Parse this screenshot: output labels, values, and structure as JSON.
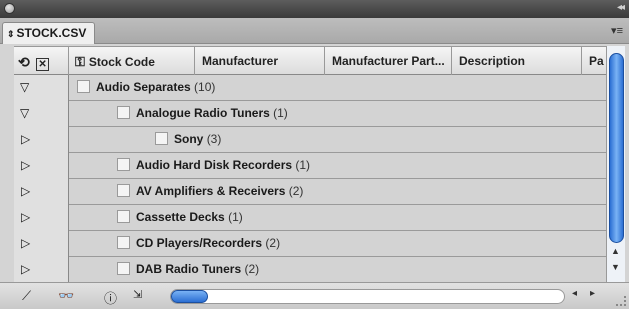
{
  "panel": {
    "tab_title": "STOCK.CSV"
  },
  "columns": [
    "Stock Code",
    "Manufacturer",
    "Manufacturer Part...",
    "Description",
    "Pa"
  ],
  "rows": [
    {
      "label": "Audio Separates",
      "count": "(10)",
      "expanded": true
    },
    {
      "label": "Analogue Radio Tuners",
      "count": "(1)",
      "expanded": true
    },
    {
      "label": "Sony",
      "count": "(3)",
      "expanded": false
    },
    {
      "label": "Audio Hard Disk Recorders",
      "count": "(1)",
      "expanded": false
    },
    {
      "label": "AV Amplifiers & Receivers",
      "count": "(2)",
      "expanded": false
    },
    {
      "label": "Cassette Decks",
      "count": "(1)",
      "expanded": false
    },
    {
      "label": "CD Players/Recorders",
      "count": "(2)",
      "expanded": false
    },
    {
      "label": "DAB Radio Tuners",
      "count": "(2)",
      "expanded": false
    }
  ]
}
